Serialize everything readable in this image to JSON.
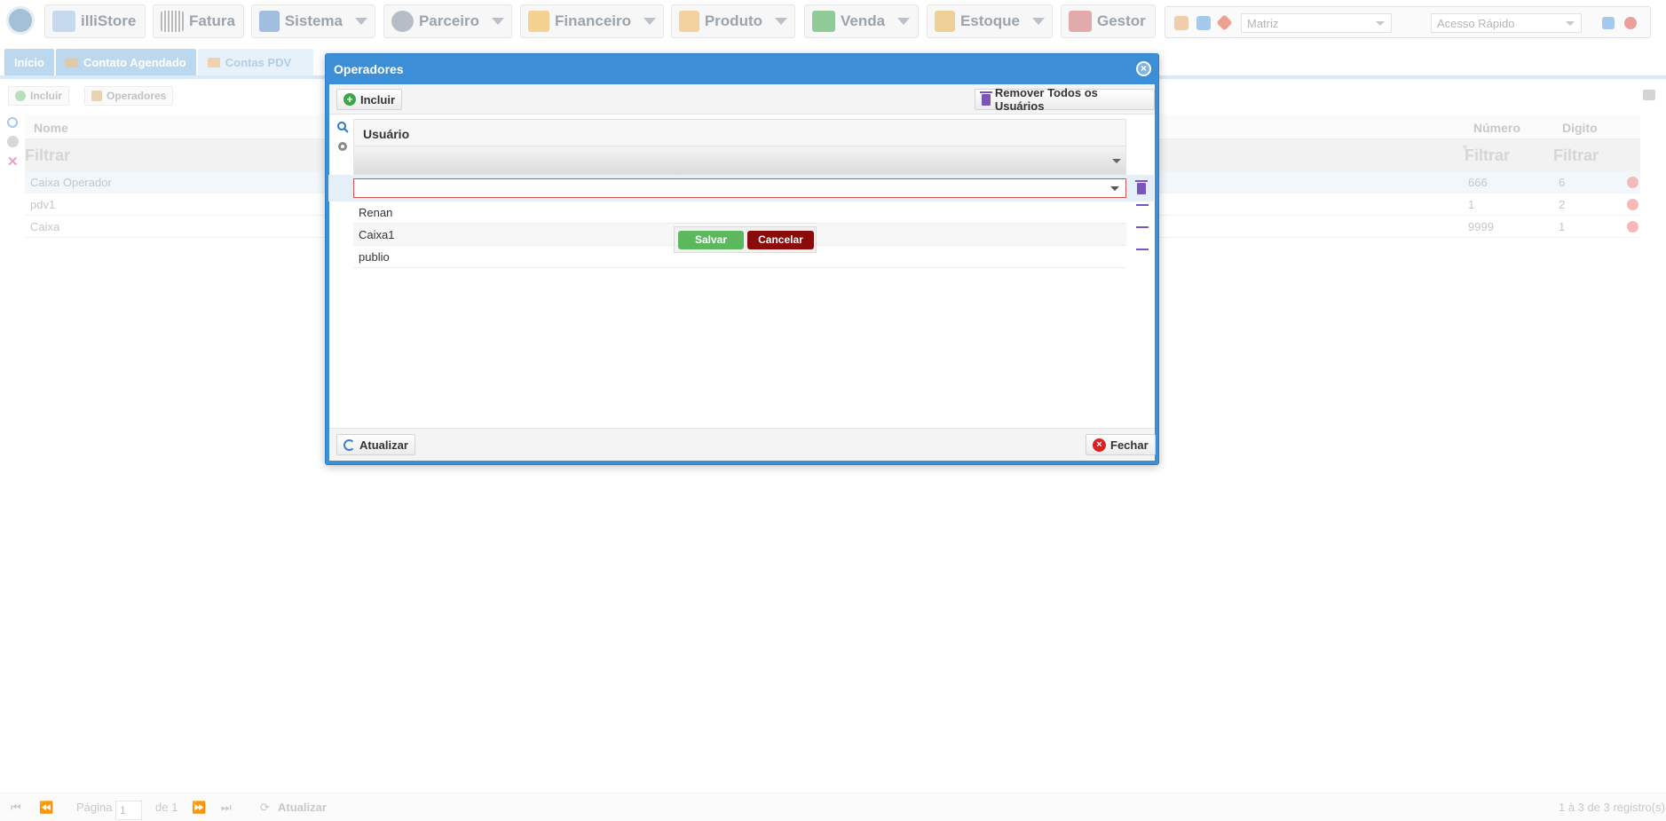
{
  "topbar": {
    "menus": [
      {
        "label": "illiStore",
        "icon": "illistore-logo-icon"
      },
      {
        "label": "Fatura",
        "icon": "barcode-icon"
      },
      {
        "label": "Sistema",
        "icon": "gear-icon"
      },
      {
        "label": "Parceiro",
        "icon": "people-icon"
      },
      {
        "label": "Financeiro",
        "icon": "bar-chart-icon"
      },
      {
        "label": "Produto",
        "icon": "box-icon"
      },
      {
        "label": "Venda",
        "icon": "cart-icon"
      },
      {
        "label": "Estoque",
        "icon": "hand-box-icon"
      },
      {
        "label": "Gestor",
        "icon": "presentation-icon"
      }
    ],
    "branch_select": "Matriz",
    "quick_access_placeholder": "Acesso Rápido"
  },
  "tabs": [
    {
      "label": "Início"
    },
    {
      "label": "Contato Agendado"
    },
    {
      "label": "Contas PDV"
    }
  ],
  "background": {
    "toolbar": {
      "include": "Incluir",
      "operators": "Operadores"
    },
    "columns": {
      "name": "Nome",
      "number": "Número",
      "digit": "Digito"
    },
    "filter_placeholder": "Filtrar",
    "rows": [
      {
        "name": "Caixa Operador",
        "number": "666",
        "digit": "6"
      },
      {
        "name": "pdv1",
        "number": "1",
        "digit": "2"
      },
      {
        "name": "Caixa",
        "number": "9999",
        "digit": "1"
      }
    ],
    "pager": {
      "page_label": "Página",
      "page_value": "1",
      "of_label": "de 1",
      "refresh": "Atualizar",
      "records": "1 à 3 de 3 registro(s)"
    }
  },
  "dialog": {
    "title": "Operadores",
    "include": "Incluir",
    "remove_all": "Remover Todos os Usuários",
    "column_user": "Usuário",
    "rows": [
      {
        "user": "Renan"
      },
      {
        "user": "Caixa1"
      },
      {
        "user": "publio"
      }
    ],
    "save": "Salvar",
    "cancel": "Cancelar",
    "refresh": "Atualizar",
    "close": "Fechar"
  },
  "colors": {
    "dialog_header": "#3c8fd6",
    "save": "#5cb85c",
    "cancel": "#8b0a0a",
    "accent_trash": "#7b55b8"
  }
}
